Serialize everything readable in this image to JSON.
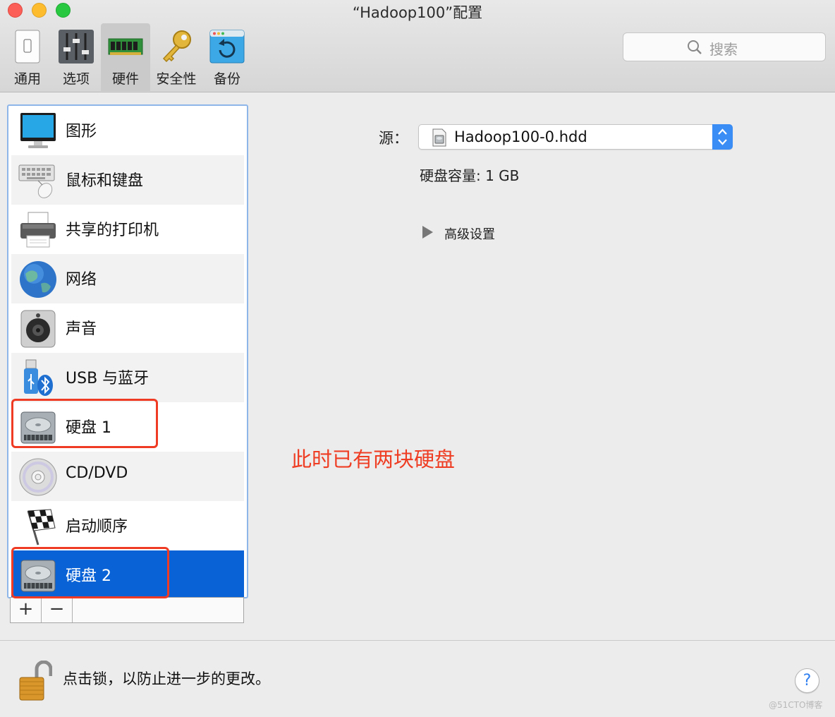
{
  "window": {
    "title": "“Hadoop100”配置"
  },
  "toolbar": {
    "items": [
      {
        "label": "通用",
        "icon": "general-switch-icon"
      },
      {
        "label": "选项",
        "icon": "sliders-icon"
      },
      {
        "label": "硬件",
        "icon": "memory-chip-icon",
        "active": true
      },
      {
        "label": "安全性",
        "icon": "key-icon"
      },
      {
        "label": "备份",
        "icon": "backup-icon"
      }
    ]
  },
  "search": {
    "placeholder": "搜索"
  },
  "sidebar": {
    "items": [
      {
        "label": "图形",
        "icon": "monitor-icon"
      },
      {
        "label": "鼠标和键盘",
        "icon": "keyboard-mouse-icon"
      },
      {
        "label": "共享的打印机",
        "icon": "printer-icon"
      },
      {
        "label": "网络",
        "icon": "globe-icon"
      },
      {
        "label": "声音",
        "icon": "speaker-icon"
      },
      {
        "label": "USB 与蓝牙",
        "icon": "usb-bluetooth-icon"
      },
      {
        "label": "硬盘 1",
        "icon": "hard-disk-icon"
      },
      {
        "label": "CD/DVD",
        "icon": "cd-dvd-icon"
      },
      {
        "label": "启动顺序",
        "icon": "checkered-flag-icon"
      },
      {
        "label": "硬盘 2",
        "icon": "hard-disk-icon",
        "selected": true
      }
    ],
    "add_label": "+",
    "remove_label": "−"
  },
  "detail": {
    "source_label": "源：",
    "source_value": "Hadoop100-0.hdd",
    "capacity": "硬盘容量: 1 GB",
    "advanced": "高级设置"
  },
  "annotation": "此时已有两块硬盘",
  "footer": {
    "lock_text": "点击锁，以防止进一步的更改。",
    "help_label": "?",
    "watermark": "@51CTO博客"
  },
  "colors": {
    "selection": "#0a63d6",
    "annotation": "#ee3d23",
    "focus_ring": "#8fb6e8"
  }
}
